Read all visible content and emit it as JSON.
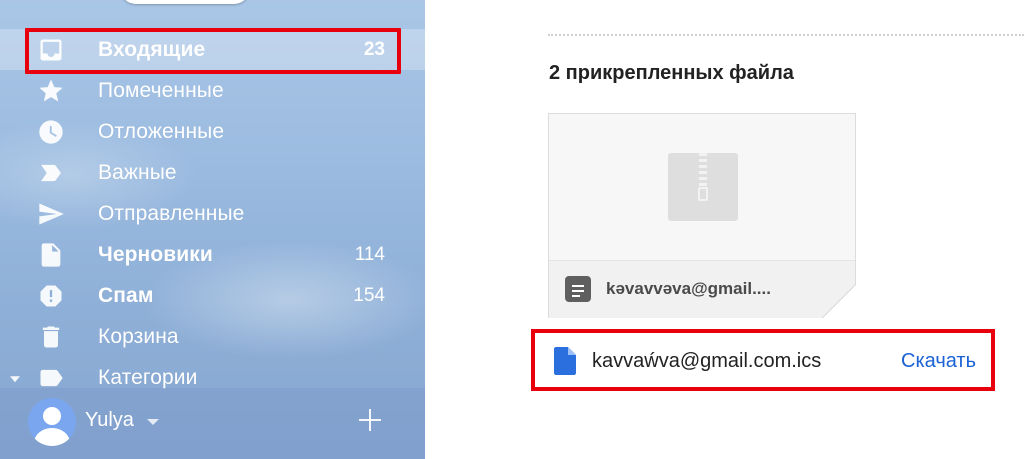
{
  "sidebar": {
    "items": [
      {
        "label": "Входящие",
        "count": "23",
        "icon": "inbox-icon",
        "bold": true,
        "active": true
      },
      {
        "label": "Помеченные",
        "count": "",
        "icon": "star-icon",
        "bold": false
      },
      {
        "label": "Отложенные",
        "count": "",
        "icon": "clock-icon",
        "bold": false
      },
      {
        "label": "Важные",
        "count": "",
        "icon": "label-important-icon",
        "bold": false
      },
      {
        "label": "Отправленные",
        "count": "",
        "icon": "send-icon",
        "bold": false
      },
      {
        "label": "Черновики",
        "count": "114",
        "icon": "draft-icon",
        "bold": true
      },
      {
        "label": "Спам",
        "count": "154",
        "icon": "spam-icon",
        "bold": true
      },
      {
        "label": "Корзина",
        "count": "",
        "icon": "trash-icon",
        "bold": false
      },
      {
        "label": "Категории",
        "count": "",
        "icon": "label-icon",
        "bold": false
      }
    ]
  },
  "account": {
    "name": "Yulya"
  },
  "attachments": {
    "title": "2 прикрепленных файла",
    "card": {
      "filename": "kəvavvəva@gmail....",
      "type_icon": "zip-file-icon"
    },
    "download": {
      "filename": "kavvaẃva@gmail.com.ics",
      "link_label": "Скачать",
      "type_icon": "document-icon"
    }
  },
  "colors": {
    "highlight": "#e8000d",
    "link": "#1a62d6",
    "doc_icon": "#2b6fde"
  }
}
